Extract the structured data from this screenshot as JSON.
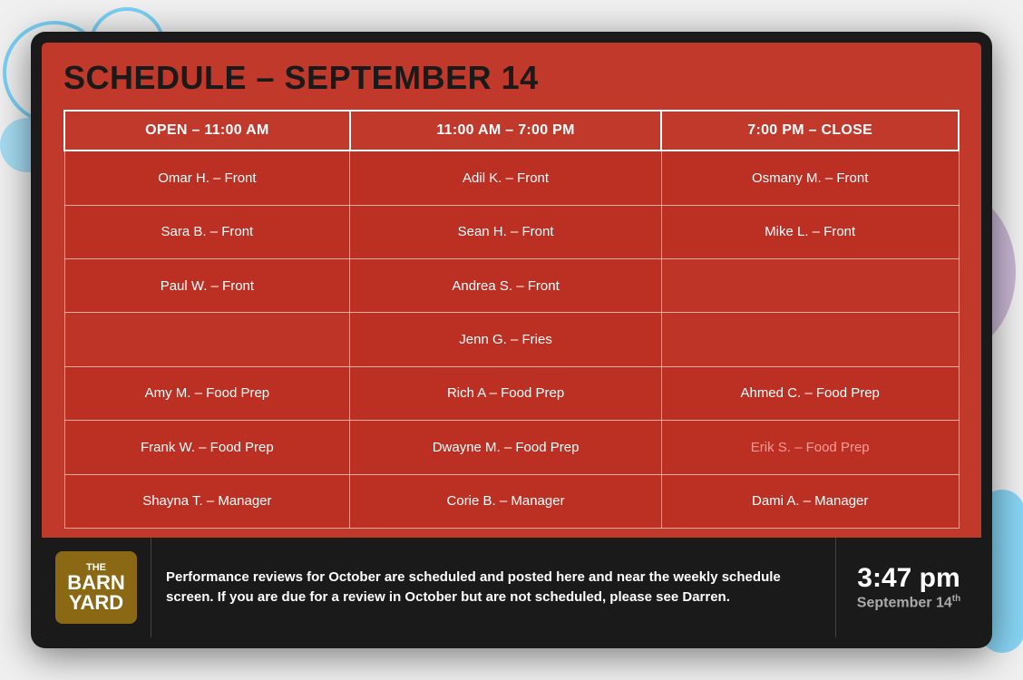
{
  "page": {
    "background_color": "#e8e8e8"
  },
  "header": {
    "title": "SCHEDULE – SEPTEMBER 14"
  },
  "table": {
    "columns": [
      {
        "id": "col1",
        "label": "OPEN – 11:00 AM"
      },
      {
        "id": "col2",
        "label": "11:00 AM – 7:00 PM"
      },
      {
        "id": "col3",
        "label": "7:00 PM – CLOSE"
      }
    ],
    "rows": [
      {
        "col1": "Omar H. – Front",
        "col2": "Adil K. – Front",
        "col3": "Osmany M. – Front",
        "col3_style": ""
      },
      {
        "col1": "Sara B. – Front",
        "col2": "Sean H. – Front",
        "col3": "Mike L. – Front",
        "col3_style": ""
      },
      {
        "col1": "Paul W. – Front",
        "col2": "Andrea S. – Front",
        "col3": "",
        "col3_style": "empty"
      },
      {
        "col1": "",
        "col1_style": "empty",
        "col2": "Jenn G. – Fries",
        "col3": "",
        "col3_style": "empty"
      },
      {
        "col1": "Amy M. – Food Prep",
        "col2": "Rich A – Food Prep",
        "col3": "Ahmed C. – Food Prep",
        "col3_style": ""
      },
      {
        "col1": "Frank W. – Food Prep",
        "col2": "Dwayne M. – Food Prep",
        "col3": "Erik S. – Food Prep",
        "col3_style": "highlight-pink"
      },
      {
        "col1": "Shayna T. – Manager",
        "col2": "Corie B. – Manager",
        "col3": "Dami A. – Manager",
        "col3_style": ""
      }
    ]
  },
  "bottom_bar": {
    "logo": {
      "the": "THE",
      "barn": "BARN",
      "yard": "YARD"
    },
    "message": "Performance reviews for October are scheduled and posted here and near the weekly schedule screen.  If you are due for a review in October but are not scheduled, please see Darren.",
    "time": "3:47 pm",
    "date": "September 14",
    "date_suffix": "th"
  }
}
